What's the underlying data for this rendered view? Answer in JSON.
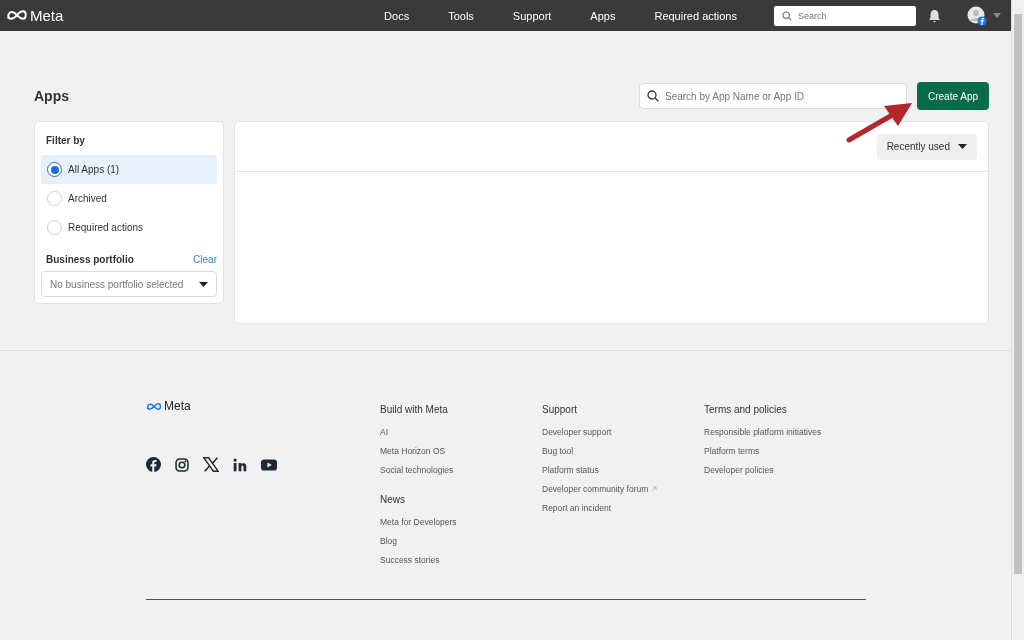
{
  "topbar": {
    "logo": "Meta",
    "nav": [
      "Docs",
      "Tools",
      "Support",
      "Apps",
      "Required actions"
    ],
    "search": {
      "placeholder": "Search"
    }
  },
  "page": {
    "title": "Apps",
    "search": {
      "placeholder": "Search by App Name or App ID"
    },
    "create_button": "Create App"
  },
  "filter": {
    "title": "Filter by",
    "options": [
      {
        "label": "All Apps (1)",
        "selected": true
      },
      {
        "label": "Archived",
        "selected": false
      },
      {
        "label": "Required actions",
        "selected": false
      }
    ],
    "portfolio": {
      "title": "Business portfolio",
      "clear": "Clear",
      "select": "No business portfolio selected"
    }
  },
  "apps_panel": {
    "sort": "Recently used"
  },
  "footer": {
    "logo": "Meta",
    "columns": [
      {
        "sections": [
          {
            "title": "Build with Meta",
            "links": [
              {
                "label": "AI",
                "external": false
              },
              {
                "label": "Meta Horizon OS",
                "external": false
              },
              {
                "label": "Social technologies",
                "external": false
              }
            ]
          },
          {
            "title": "News",
            "links": [
              {
                "label": "Meta for Developers",
                "external": false
              },
              {
                "label": "Blog",
                "external": false
              },
              {
                "label": "Success stories",
                "external": false
              }
            ]
          }
        ]
      },
      {
        "sections": [
          {
            "title": "Support",
            "links": [
              {
                "label": "Developer support",
                "external": false
              },
              {
                "label": "Bug tool",
                "external": false
              },
              {
                "label": "Platform status",
                "external": false
              },
              {
                "label": "Developer community forum",
                "external": true
              },
              {
                "label": "Report an incident",
                "external": false
              }
            ]
          }
        ]
      },
      {
        "sections": [
          {
            "title": "Terms and policies",
            "links": [
              {
                "label": "Responsible platform initiatives",
                "external": false
              },
              {
                "label": "Platform terms",
                "external": false
              },
              {
                "label": "Developer policies",
                "external": false
              }
            ]
          }
        ]
      }
    ]
  }
}
